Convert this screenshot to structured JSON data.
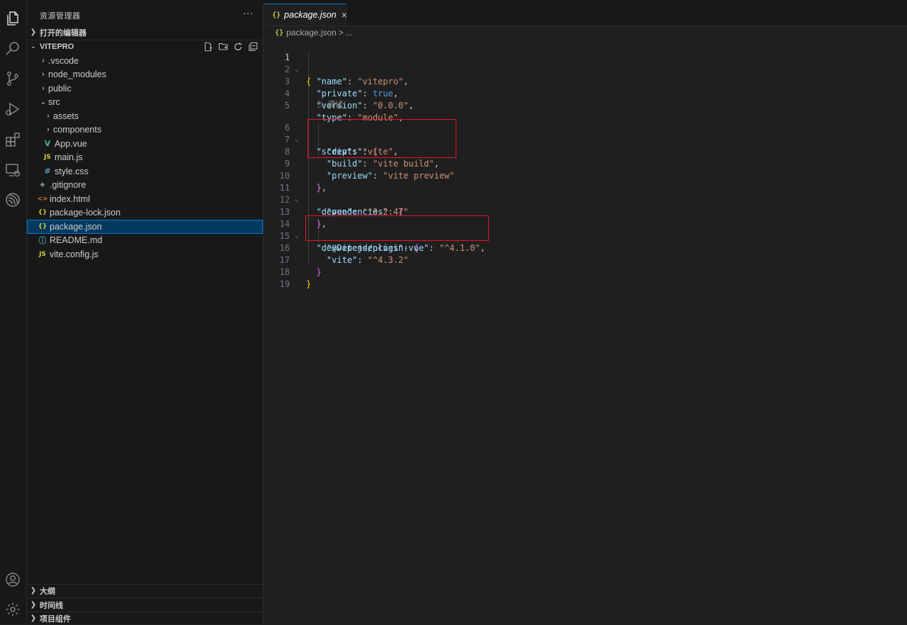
{
  "sidebar": {
    "title": "资源管理器",
    "more": "···",
    "open_editors": "打开的编辑器",
    "project": "VITEPRO",
    "outline": "大纲",
    "timeline": "时间线",
    "project_components": "项目组件",
    "tree": [
      {
        "label": ".vscode"
      },
      {
        "label": "node_modules"
      },
      {
        "label": "public"
      },
      {
        "label": "src"
      },
      {
        "label": "assets"
      },
      {
        "label": "components"
      },
      {
        "label": "App.vue",
        "icon": "V"
      },
      {
        "label": "main.js",
        "icon": "JS"
      },
      {
        "label": "style.css",
        "icon": "#"
      },
      {
        "label": ".gitignore",
        "icon": "◆"
      },
      {
        "label": "index.html",
        "icon": "<>"
      },
      {
        "label": "package-lock.json",
        "icon": "{}"
      },
      {
        "label": "package.json",
        "icon": "{}"
      },
      {
        "label": "README.md",
        "icon": "ⓘ"
      },
      {
        "label": "vite.config.js",
        "icon": "JS"
      }
    ]
  },
  "tab": {
    "label": "package.json",
    "icon": "{}",
    "close": "×"
  },
  "breadcrumb": {
    "file": "package.json",
    "sep": ">",
    "rest": "..."
  },
  "codelens": "调试",
  "code": {
    "line_numbers": [
      "1",
      "2",
      "3",
      "4",
      "5",
      "6",
      "7",
      "8",
      "9",
      "10",
      "11",
      "12",
      "13",
      "14",
      "15",
      "16",
      "17",
      "18",
      "19"
    ],
    "name_key": "\"name\"",
    "name_val": "\"vitepro\"",
    "private_key": "\"private\"",
    "private_val": "true",
    "version_key": "\"version\"",
    "version_val": "\"0.0.0\"",
    "type_key": "\"type\"",
    "type_val": "\"module\"",
    "scripts_key": "\"scripts\"",
    "dev_key": "\"dev\"",
    "dev_val": "\"vite\"",
    "build_key": "\"build\"",
    "build_val": "\"vite build\"",
    "preview_key": "\"preview\"",
    "preview_val": "\"vite preview\"",
    "deps_key": "\"dependencies\"",
    "vue_key": "\"vue\"",
    "vue_val": "\"^3.2.47\"",
    "devdeps_key": "\"devDependencies\"",
    "plugin_key": "\"@vitejs/plugin-vue\"",
    "plugin_val": "\"^4.1.0\"",
    "vite_key": "\"vite\"",
    "vite_val": "\"^4.3.2\""
  },
  "colors": {
    "accent": "#0078d4",
    "highlight_box": "#e81123",
    "string": "#ce9178",
    "key": "#9cdcfe",
    "bool": "#569cd6"
  }
}
